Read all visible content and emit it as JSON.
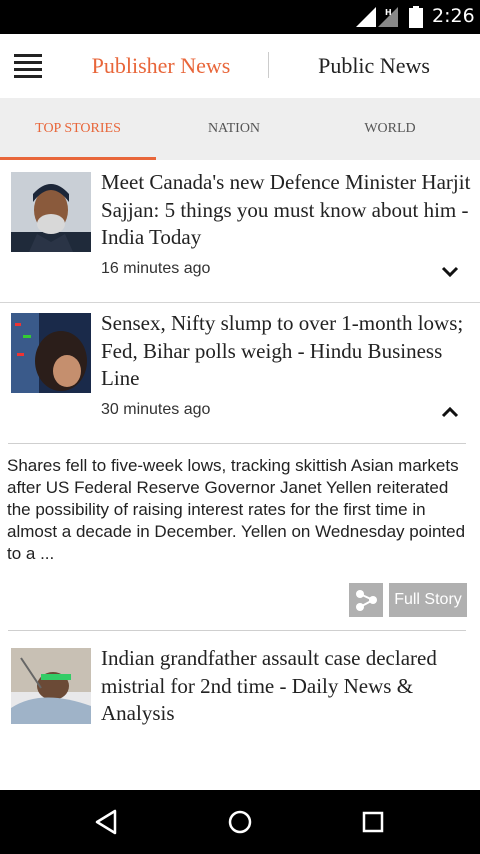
{
  "status_bar": {
    "time": "2:26",
    "network_badge": "H",
    "icons": [
      "signal-icon",
      "signal-h-icon",
      "battery-icon"
    ]
  },
  "header": {
    "menu_icon": "hamburger-menu-icon",
    "tabs": [
      {
        "label": "Publisher News",
        "active": true
      },
      {
        "label": "Public News",
        "active": false
      }
    ],
    "accent_color": "#e8663a"
  },
  "section_tabs": [
    {
      "label": "TOP STORIES",
      "active": true
    },
    {
      "label": "NATION",
      "active": false
    },
    {
      "label": "WORLD",
      "active": false
    }
  ],
  "stories": [
    {
      "headline": "Meet Canada's new Defence Minister Harjit Sajjan: 5 things you must know about him - India Today",
      "time": "16 minutes ago",
      "expanded": false,
      "thumb_icon": "news-thumbnail"
    },
    {
      "headline": "Sensex, Nifty slump to over 1-month lows; Fed, Bihar polls weigh - Hindu Business Line",
      "time": "30 minutes ago",
      "expanded": true,
      "summary": "Shares fell to five-week lows, tracking skittish Asian markets after US Federal Reserve Governor Janet Yellen reiterated the possibility of raising interest rates for the first time in almost a decade in December. Yellen on Wednesday pointed to a ...",
      "share_icon": "share-icon",
      "full_story_label": "Full Story",
      "thumb_icon": "news-thumbnail"
    },
    {
      "headline": "Indian grandfather assault case declared mistrial for 2nd time - Daily News & Analysis",
      "thumb_icon": "news-thumbnail"
    }
  ],
  "nav_bar": {
    "icons": [
      "back-icon",
      "home-icon",
      "recents-icon"
    ]
  }
}
